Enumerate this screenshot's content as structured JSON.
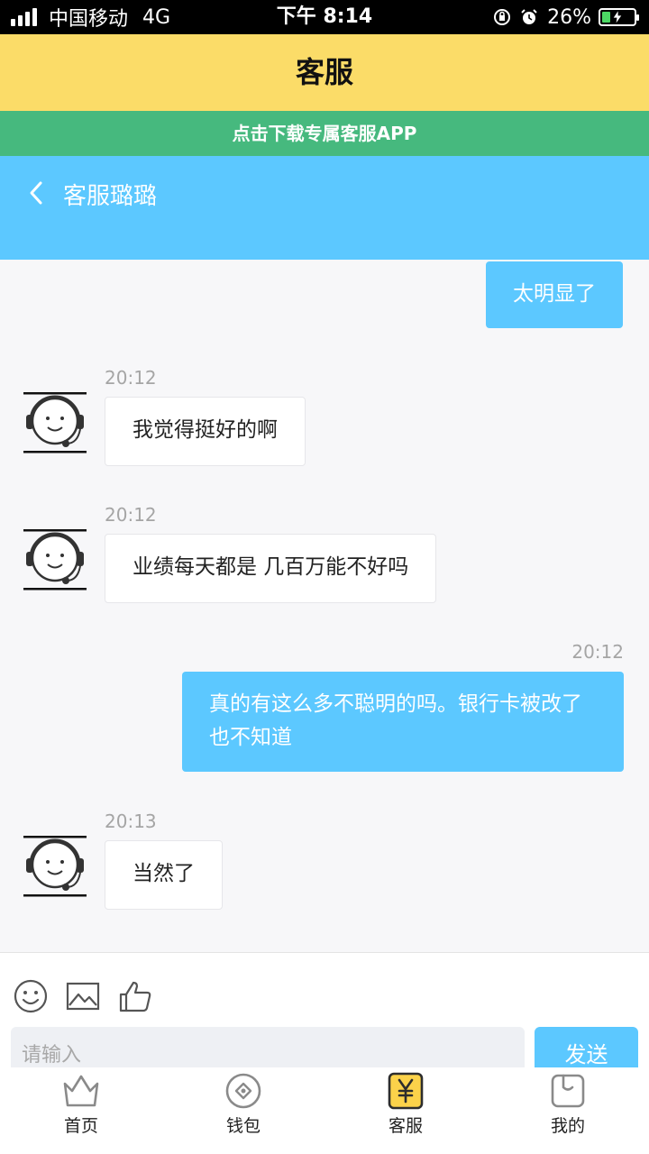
{
  "status_bar": {
    "carrier": "中国移动",
    "network": "4G",
    "time": "下午 8:14",
    "battery": "26%",
    "battery_level": 0.26
  },
  "header": {
    "title": "客服",
    "download_banner": "点击下载专属客服APP"
  },
  "chat": {
    "agent_name": "客服璐璐",
    "messages": [
      {
        "from": "me",
        "time": "",
        "text": "太明显了"
      },
      {
        "from": "agent",
        "time": "20:12",
        "text": "我觉得挺好的啊"
      },
      {
        "from": "agent",
        "time": "20:12",
        "text": "业绩每天都是 几百万能不好吗"
      },
      {
        "from": "me",
        "time": "20:12",
        "text": "真的有这么多不聪明的吗。银行卡被改了也不知道"
      },
      {
        "from": "agent",
        "time": "20:13",
        "text": "当然了"
      }
    ]
  },
  "composer": {
    "placeholder": "请输入",
    "send_label": "发送",
    "tools": [
      "emoji-icon",
      "image-icon",
      "thumbs-up-icon"
    ]
  },
  "tab_bar": {
    "items": [
      {
        "label": "首页",
        "icon": "crown-icon"
      },
      {
        "label": "钱包",
        "icon": "coin-icon"
      },
      {
        "label": "客服",
        "icon": "yuan-icon"
      },
      {
        "label": "我的",
        "icon": "profile-icon"
      }
    ]
  },
  "colors": {
    "header_yellow": "#fbdc68",
    "banner_green": "#46b97e",
    "accent_blue": "#5cc8ff"
  }
}
